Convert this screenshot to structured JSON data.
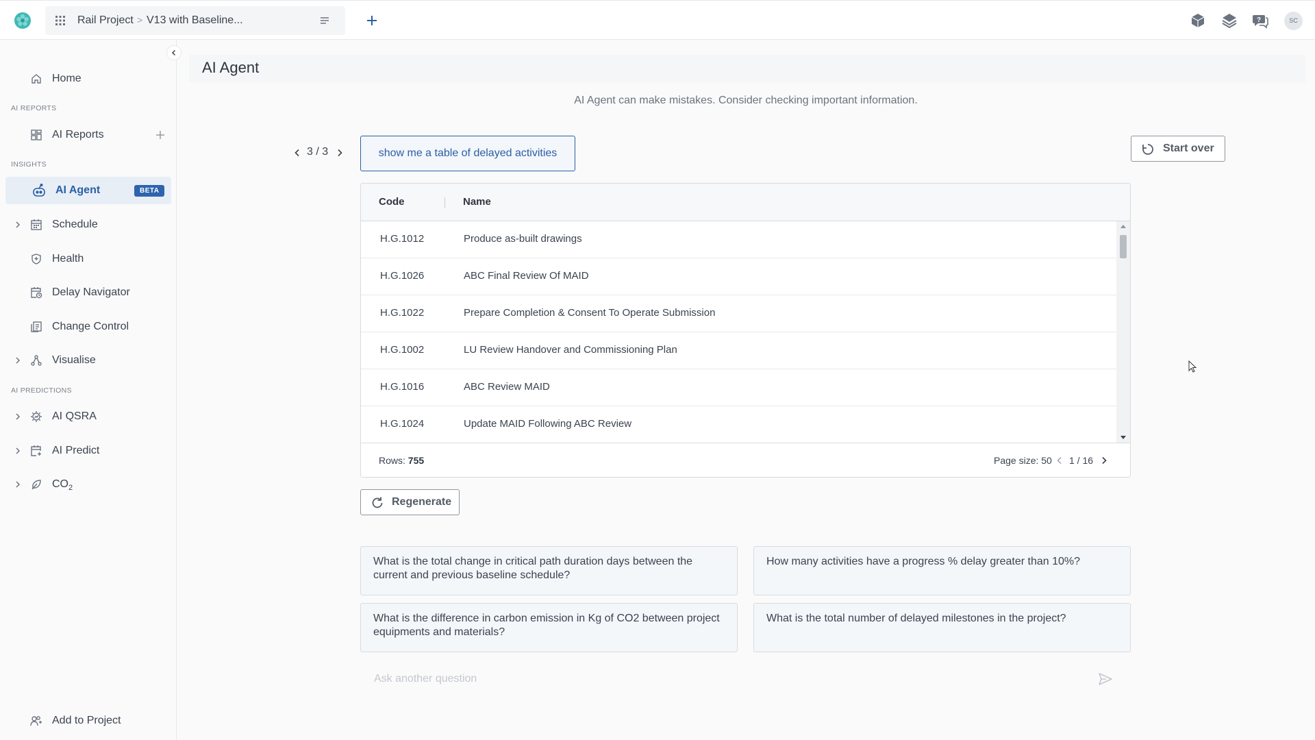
{
  "topbar": {
    "project": "Rail Project",
    "separator": ">",
    "version": "V13 with Baseline...",
    "avatar_initials": "SC",
    "icons": [
      "grid-icon",
      "hamburger-icon",
      "plus-icon",
      "cube-icon",
      "layers-icon",
      "chat-help-icon"
    ]
  },
  "sidebar": {
    "home": "Home",
    "section_ai_reports": "AI REPORTS",
    "ai_reports": "AI Reports",
    "section_insights": "INSIGHTS",
    "ai_agent": "AI Agent",
    "beta": "BETA",
    "schedule": "Schedule",
    "health": "Health",
    "delay_navigator": "Delay Navigator",
    "change_control": "Change Control",
    "visualise": "Visualise",
    "section_ai_predictions": "AI PREDICTIONS",
    "ai_qsra": "AI QSRA",
    "ai_predict": "AI Predict",
    "co2": "CO",
    "co2_sub": "2",
    "add_to_project": "Add to Project"
  },
  "main": {
    "title": "AI Agent",
    "disclaimer": "AI Agent can make mistakes. Consider checking important information.",
    "pager": "3 / 3",
    "query": "show me a table of delayed activities",
    "start_over": "Start over",
    "regenerate": "Regenerate",
    "ask_placeholder": "Ask another question"
  },
  "table": {
    "headers": {
      "code": "Code",
      "name": "Name"
    },
    "rows": [
      {
        "code": "H.G.1012",
        "name": "Produce as-built drawings"
      },
      {
        "code": "H.G.1026",
        "name": "ABC Final Review Of MAID"
      },
      {
        "code": "H.G.1022",
        "name": "Prepare Completion & Consent To Operate Submission"
      },
      {
        "code": "H.G.1002",
        "name": "LU Review Handover and Commissioning Plan"
      },
      {
        "code": "H.G.1016",
        "name": "ABC Review MAID"
      },
      {
        "code": "H.G.1024",
        "name": "Update MAID Following ABC Review"
      }
    ],
    "rows_label": "Rows:",
    "rows_count": "755",
    "page_size": "Page size: 50",
    "page": "1 / 16"
  },
  "suggestions": [
    "What is the total change in critical path duration days between the current and previous baseline schedule?",
    "How many activities have a progress % delay greater than 10%?",
    "What is the difference in carbon emission in Kg of CO2 between project equipments and materials?",
    "What is the total number of delayed milestones in the project?"
  ],
  "colors": {
    "accent": "#2b5fa6",
    "beta_badge": "#2e64ae",
    "active_bg": "#e8eef6",
    "logo": "#3fb8b5"
  }
}
